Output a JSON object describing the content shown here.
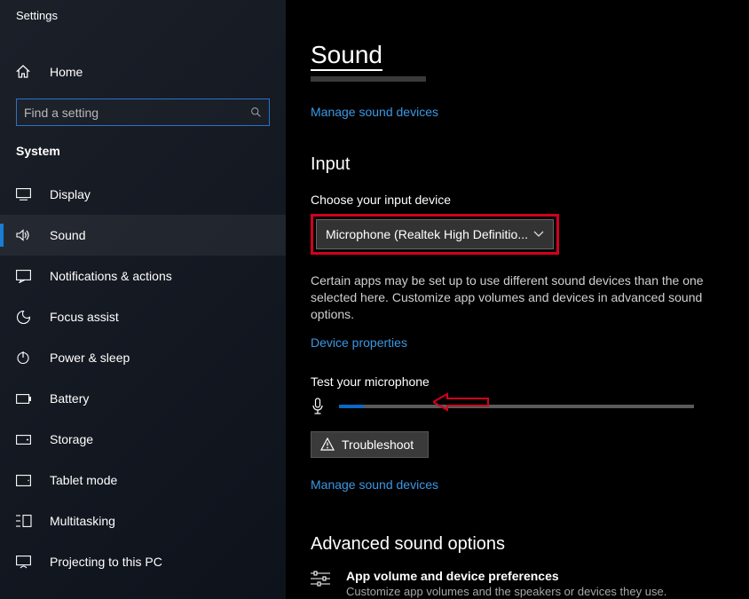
{
  "app": {
    "title": "Settings"
  },
  "sidebar": {
    "home_label": "Home",
    "search_placeholder": "Find a setting",
    "section_label": "System",
    "items": [
      {
        "label": "Display"
      },
      {
        "label": "Sound"
      },
      {
        "label": "Notifications & actions"
      },
      {
        "label": "Focus assist"
      },
      {
        "label": "Power & sleep"
      },
      {
        "label": "Battery"
      },
      {
        "label": "Storage"
      },
      {
        "label": "Tablet mode"
      },
      {
        "label": "Multitasking"
      },
      {
        "label": "Projecting to this PC"
      }
    ],
    "active_index": 1
  },
  "main": {
    "title": "Sound",
    "manage_devices_link": "Manage sound devices",
    "input_header": "Input",
    "choose_label": "Choose your input device",
    "dropdown_value": "Microphone (Realtek High Definitio...",
    "description": "Certain apps may be set up to use different sound devices than the one selected here. Customize app volumes and devices in advanced sound options.",
    "device_properties_link": "Device properties",
    "test_label": "Test your microphone",
    "mic_level_percent": 7,
    "troubleshoot_label": "Troubleshoot",
    "manage_devices_link_2": "Manage sound devices",
    "advanced_header": "Advanced sound options",
    "advanced_item_title": "App volume and device preferences",
    "advanced_item_desc": "Customize app volumes and the speakers or devices they use."
  },
  "annotations": {
    "dropdown_highlight_color": "#d2001f",
    "arrow_color": "#d2001f"
  }
}
